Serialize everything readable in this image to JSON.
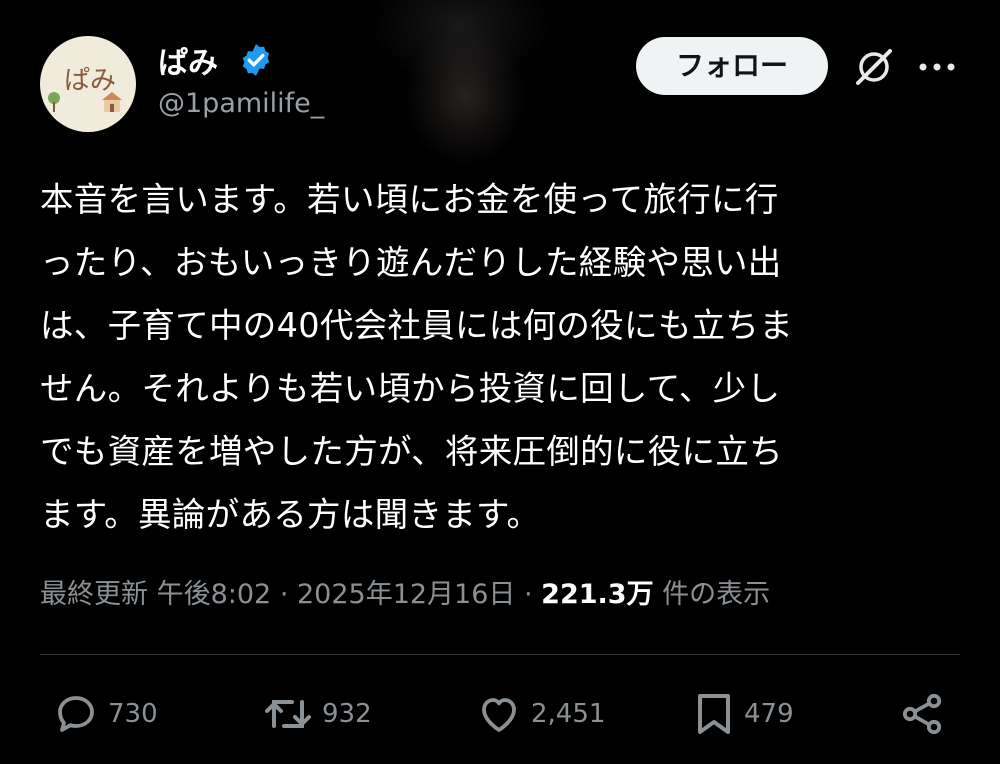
{
  "author": {
    "avatar_text": "ぱみ",
    "display_name": "ぱみ",
    "handle": "@1pamilife_"
  },
  "header": {
    "follow_label": "フォロー"
  },
  "tweet": {
    "lines": [
      "本音を言います。若い頃にお金を使って旅行に行",
      "ったり、おもいっきり遊んだりした経験や思い出",
      "は、子育て中の40代会社員には何の役にも立ちま",
      "せん。それよりも若い頃から投資に回して、少し",
      "でも資産を増やした方が、将来圧倒的に役に立ち",
      "ます。異論がある方は聞きます。"
    ]
  },
  "meta": {
    "updated_label": "最終更新",
    "time": "午後8:02",
    "sep1": " · ",
    "date": "2025年12月16日",
    "sep2": " · ",
    "views": "221.3万",
    "views_suffix": " 件の表示"
  },
  "actions": {
    "replies": "730",
    "reposts": "932",
    "likes": "2,451",
    "bookmarks": "479"
  },
  "colors": {
    "background": "#000000",
    "text": "#ffffff",
    "secondary": "#8b9095",
    "verified": "#1d9bf0",
    "follow_bg": "#eff3f4"
  }
}
